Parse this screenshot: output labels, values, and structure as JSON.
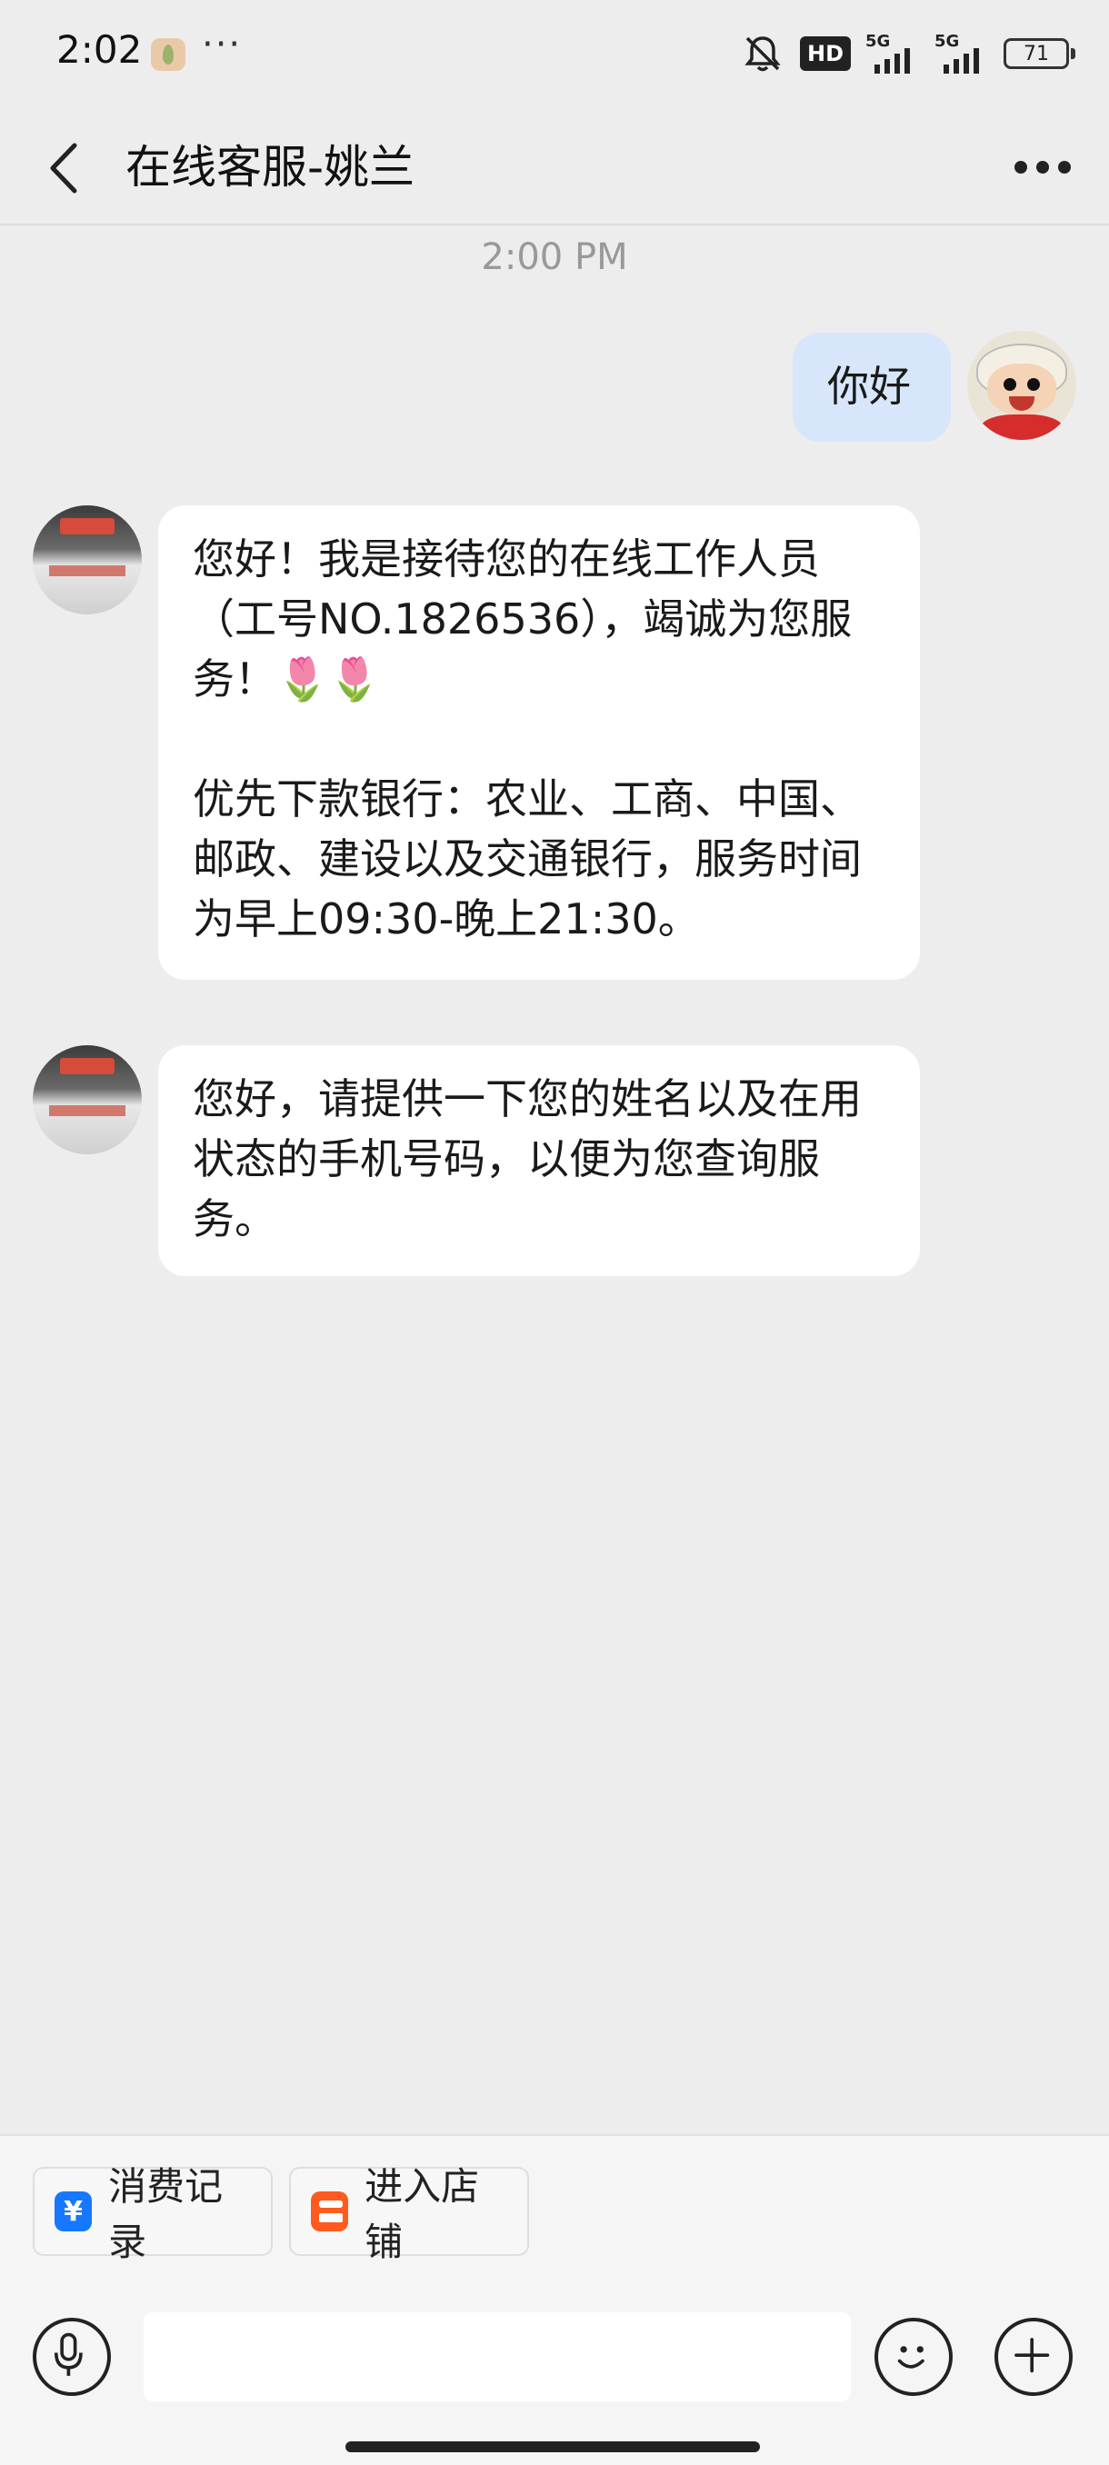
{
  "status_bar": {
    "time": "2:02",
    "more_dots": "···",
    "hd_label": "HD",
    "network_1": "5G",
    "network_2": "5G",
    "battery": "71"
  },
  "nav": {
    "title": "在线客服-姚兰"
  },
  "chat": {
    "timestamp": "2:00 PM",
    "messages": [
      {
        "from": "me",
        "text": "你好"
      },
      {
        "from": "agent",
        "text": "您好！我是接待您的在线工作人员（工号NO.1826536），竭诚为您服务！🌷🌷\n\n优先下款银行：农业、工商、中国、邮政、建设以及交通银行，服务时间为早上09:30-晚上21:30。"
      },
      {
        "from": "agent",
        "text": "您好，请提供一下您的姓名以及在用状态的手机号码，以便为您查询服务。"
      }
    ]
  },
  "quick_actions": {
    "records": {
      "icon_glyph": "¥",
      "label": "消费记录"
    },
    "shop": {
      "label": "进入店铺"
    }
  },
  "composer": {
    "placeholder": ""
  },
  "colors": {
    "background": "#ededed",
    "my_bubble": "#d8e6fb",
    "their_bubble": "#ffffff",
    "records_icon": "#1677ff",
    "shop_icon": "#ff5a1f"
  }
}
